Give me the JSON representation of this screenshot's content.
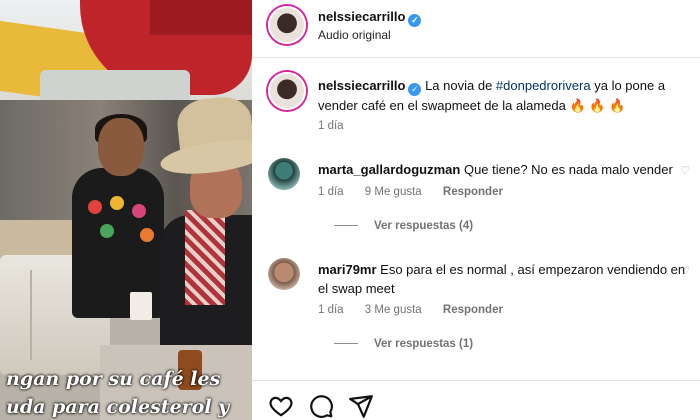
{
  "header": {
    "username": "nelssiecarrillo",
    "subtitle": "Audio original"
  },
  "post": {
    "username": "nelssiecarrillo",
    "text_before": "La novia de ",
    "mention": "#donpedrorivera",
    "text_after": " ya lo pone a vender café en el swapmeet de la alameda",
    "emoji": "🔥 🔥 🔥",
    "time": "1 día"
  },
  "comments": [
    {
      "username": "marta_gallardoguzman",
      "text": "Que tiene? No es nada malo vender",
      "time": "1 día",
      "likes": "9 Me gusta",
      "reply": "Responder",
      "view_replies": "Ver respuestas (4)"
    },
    {
      "username": "mari79mr",
      "text": "Eso para el es normal , así empezaron vendiendo en el swap meet",
      "time": "1 día",
      "likes": "3 Me gusta",
      "reply": "Responder",
      "view_replies": "Ver respuestas (1)"
    }
  ],
  "video_caption": {
    "line1": "ngan por su café  les",
    "line2": "uda para colesterol y"
  },
  "colors": {
    "verified": "#3897f0",
    "mention": "#00376b",
    "meta": "#737373"
  },
  "icons": [
    "verified-badge-icon",
    "heart-icon",
    "comment-icon",
    "share-icon"
  ]
}
